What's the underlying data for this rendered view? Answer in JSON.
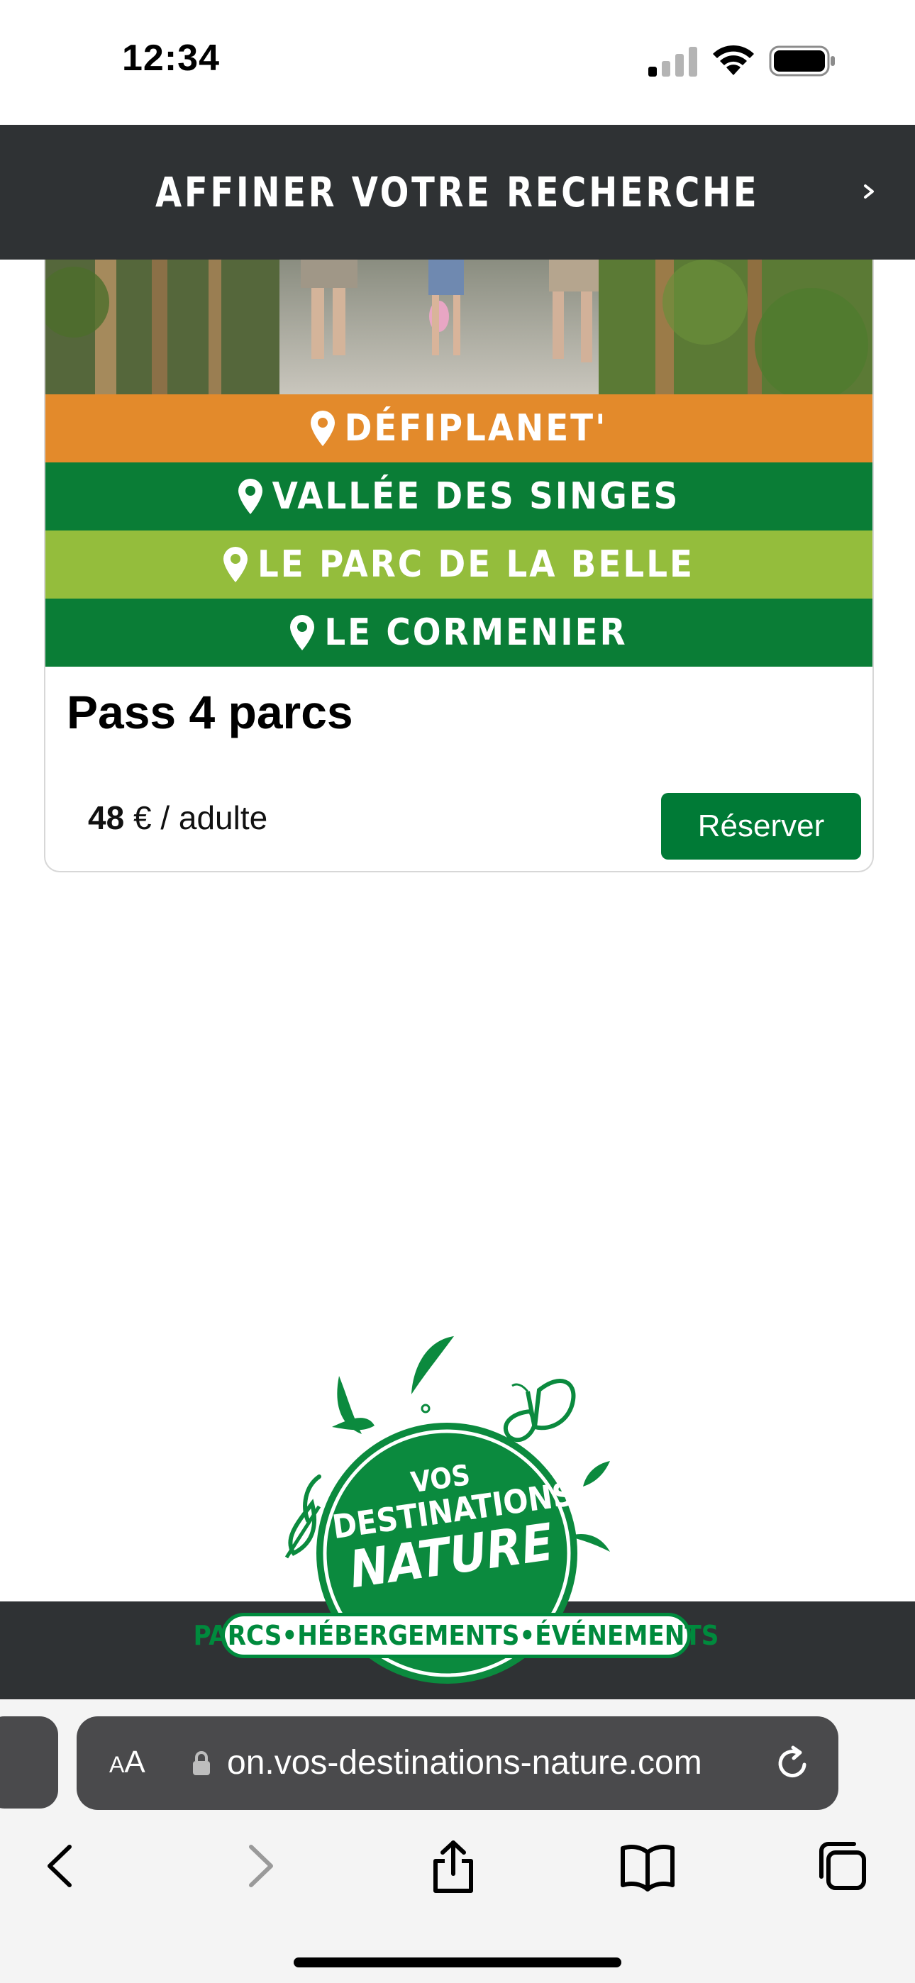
{
  "status_bar": {
    "time": "12:34"
  },
  "refine_bar": {
    "title": "AFFINER VOTRE RECHERCHE"
  },
  "card": {
    "parks": [
      {
        "name": "DÉFIPLANET'",
        "color": "#e38a2b"
      },
      {
        "name": "VALLÉE DES SINGES",
        "color": "#0a7d36"
      },
      {
        "name": "LE PARC DE LA BELLE",
        "color": "#94bd3c"
      },
      {
        "name": "LE CORMENIER",
        "color": "#0a7d36"
      }
    ],
    "title": "Pass 4 parcs",
    "price_amount": "48",
    "price_unit": " € / adulte",
    "reserve_label": "Réserver"
  },
  "footer": {
    "logo_line1": "VOS",
    "logo_line2": "DESTINATIONS",
    "logo_line3": "NATURE",
    "tagline": "PARCS•HÉBERGEMENTS•ÉVÉNEMENTS"
  },
  "safari": {
    "text_size_label": "AA",
    "url": "on.vos-destinations-nature.com"
  },
  "colors": {
    "brand_green": "#007a36",
    "dark_bar": "#2f3234"
  }
}
